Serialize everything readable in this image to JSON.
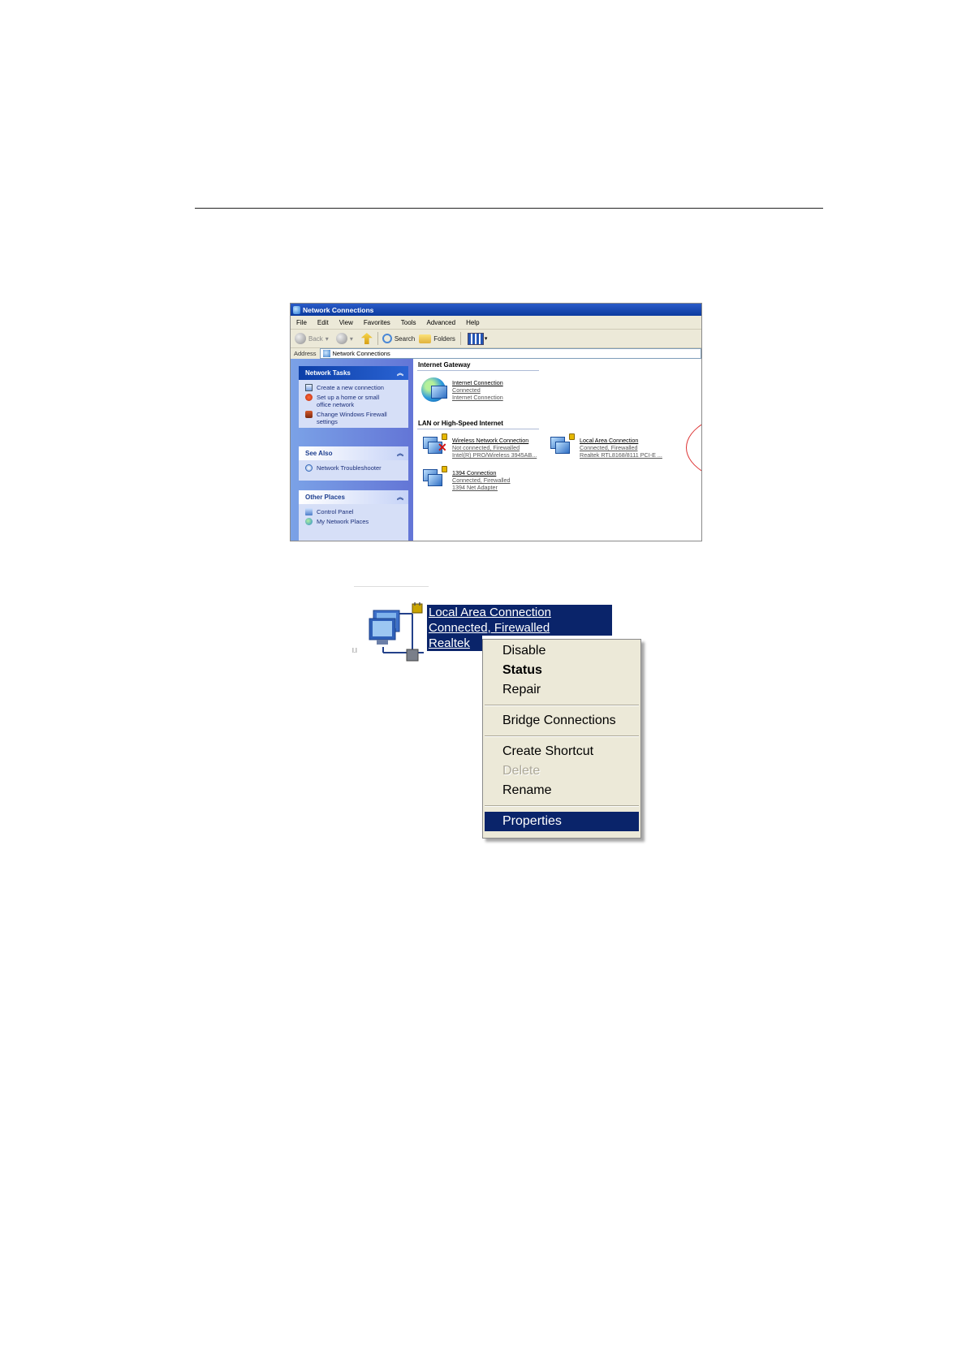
{
  "window": {
    "title": "Network Connections",
    "menu": [
      "File",
      "Edit",
      "View",
      "Favorites",
      "Tools",
      "Advanced",
      "Help"
    ],
    "toolbar": {
      "back": "Back",
      "search": "Search",
      "folders": "Folders"
    },
    "address": {
      "label": "Address",
      "value": "Network Connections"
    },
    "network_tasks": {
      "title": "Network Tasks",
      "items": [
        [
          "Create a new connection"
        ],
        [
          "Set up a home or small",
          "office network"
        ],
        [
          "Change Windows Firewall",
          "settings"
        ]
      ]
    },
    "see_also": {
      "title": "See Also",
      "items": [
        "Network Troubleshooter"
      ]
    },
    "other_places": {
      "title": "Other Places",
      "items": [
        "Control Panel",
        "My Network Places"
      ]
    },
    "groups": {
      "gateway": {
        "title": "Internet Gateway",
        "connections": [
          {
            "name": "Internet Connection",
            "status": "Connected",
            "device": "Internet Connection"
          }
        ]
      },
      "lan": {
        "title": "LAN or High-Speed Internet",
        "connections": [
          {
            "name": "Wireless Network Connection",
            "status": "Not connected, Firewalled",
            "device": "Intel(R) PRO/Wireless 3945AB..."
          },
          {
            "name": "Local Area Connection",
            "status": "Connected, Firewalled",
            "device": "Realtek RTL8168/8111 PCI-E ..."
          },
          {
            "name": "1394 Connection",
            "status": "Connected, Firewalled",
            "device": "1394 Net Adapter"
          }
        ]
      }
    }
  },
  "context": {
    "labels": [
      "Local Area Connection",
      "Connected, Firewalled",
      "Realtek"
    ],
    "small_mark": "l.l",
    "menu_items": [
      {
        "label": "Disable",
        "style": "normal"
      },
      {
        "label": "Status",
        "style": "bold"
      },
      {
        "label": "Repair",
        "style": "normal"
      },
      {
        "label": "Bridge Connections",
        "style": "normal"
      },
      {
        "label": "Create Shortcut",
        "style": "normal"
      },
      {
        "label": "Delete",
        "style": "disabled"
      },
      {
        "label": "Rename",
        "style": "normal"
      },
      {
        "label": "Properties",
        "style": "highlighted"
      }
    ]
  },
  "colors": {
    "selection": "#0a246a",
    "menu_bg": "#ece9d8",
    "task_pane": "#6375d6",
    "annotation": "#dd3333"
  }
}
